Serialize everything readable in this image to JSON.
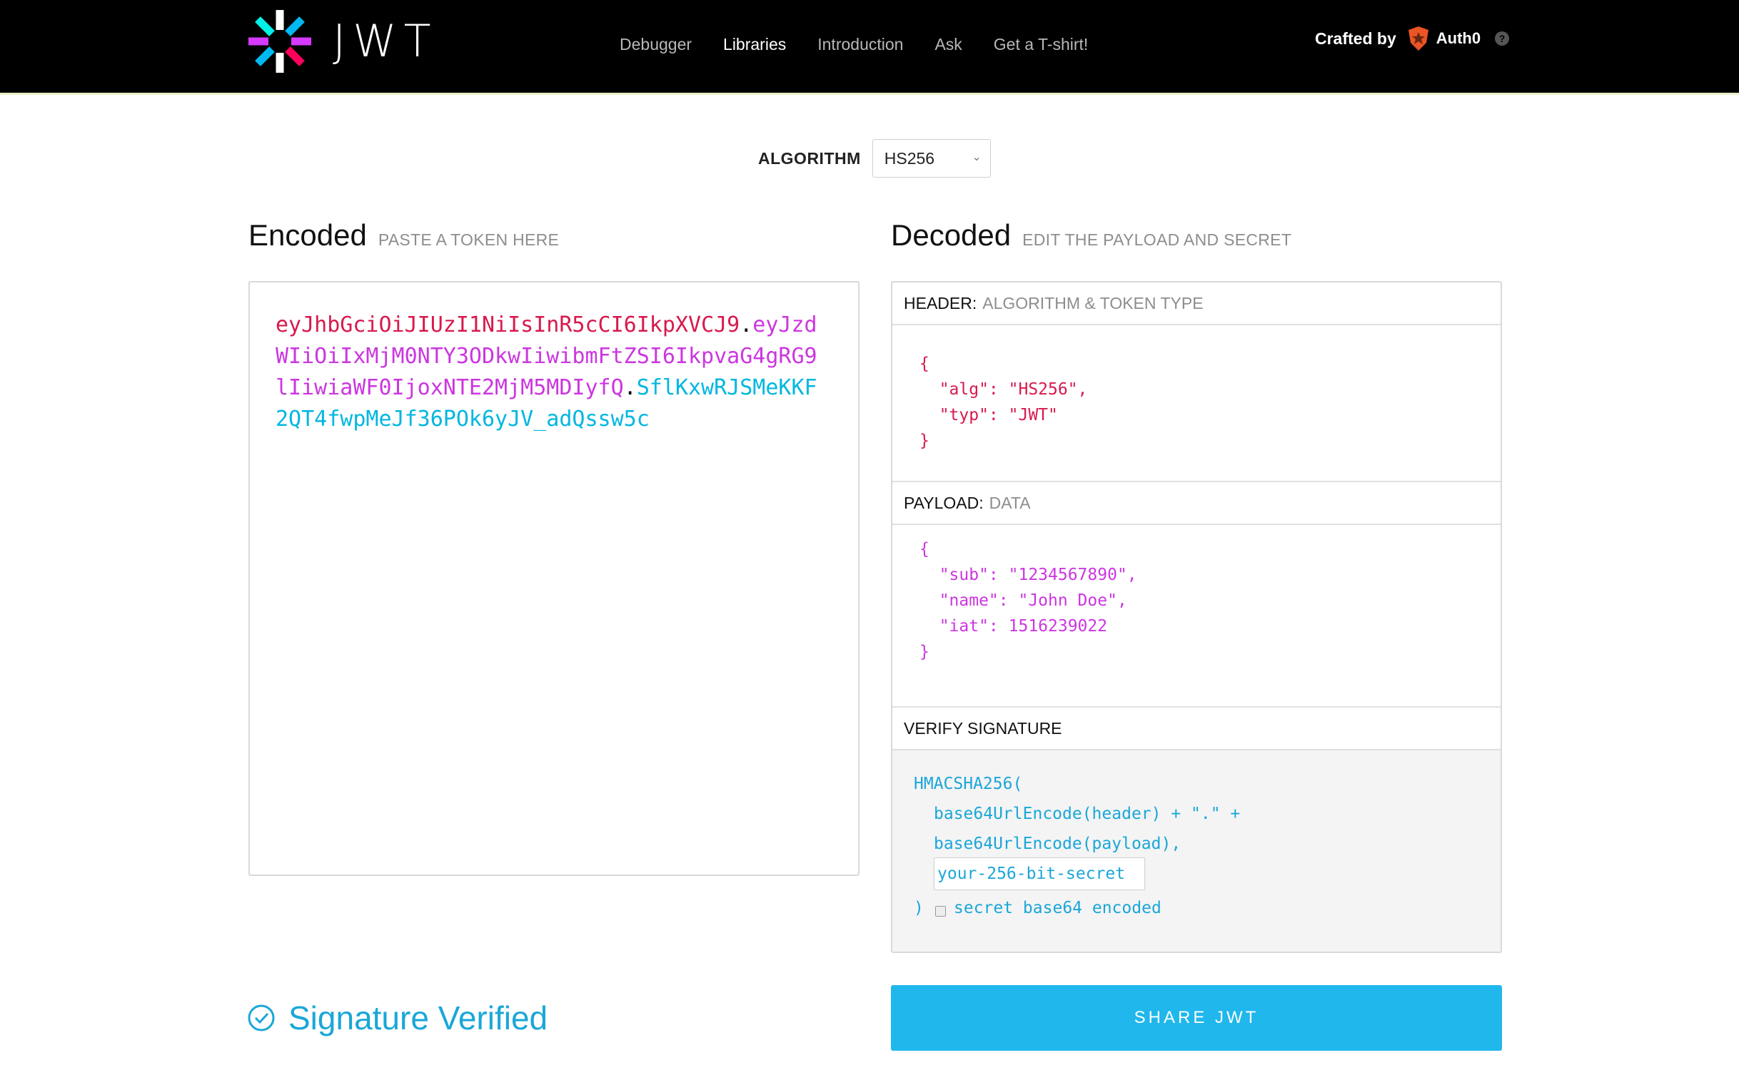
{
  "brand": {
    "name": "JWT"
  },
  "nav": {
    "items": [
      "Debugger",
      "Libraries",
      "Introduction",
      "Ask",
      "Get a T-shirt!"
    ],
    "active": "Libraries"
  },
  "crafted": {
    "label": "Crafted by",
    "company": "Auth0",
    "help_glyph": "?"
  },
  "algorithm": {
    "label": "ALGORITHM",
    "value": "HS256"
  },
  "encoded": {
    "title": "Encoded",
    "hint": "PASTE A TOKEN HERE",
    "token_header": "eyJhbGciOiJIUzI1NiIsInR5cCI6IkpXVCJ9",
    "token_payload": "eyJzdWIiOiIxMjM0NTY3ODkwIiwibmFtZSI6IkpvaG4gRG9lIiwiaWF0IjoxNTE2MjM5MDIyfQ",
    "token_signature": "SflKxwRJSMeKKF2QT4fwpMeJf36POk6yJV_adQssw5c",
    "dot": "."
  },
  "decoded": {
    "title": "Decoded",
    "hint": "EDIT THE PAYLOAD AND SECRET",
    "header_section": {
      "label": "HEADER:",
      "sublabel": "ALGORITHM & TOKEN TYPE",
      "json": "{\n  \"alg\": \"HS256\",\n  \"typ\": \"JWT\"\n}"
    },
    "payload_section": {
      "label": "PAYLOAD:",
      "sublabel": "DATA",
      "json": "{\n  \"sub\": \"1234567890\",\n  \"name\": \"John Doe\",\n  \"iat\": 1516239022\n}"
    },
    "verify_section": {
      "label": "VERIFY SIGNATURE",
      "line1": "HMACSHA256(",
      "line2": "base64UrlEncode(header) + \".\" +",
      "line3": "base64UrlEncode(payload),",
      "secret_placeholder": "your-256-bit-secret",
      "close_paren": ")",
      "checkbox_label": "secret base64 encoded"
    }
  },
  "status": {
    "text": "Signature Verified"
  },
  "share_button": {
    "label": "SHARE JWT"
  },
  "colors": {
    "header_red": "#d8194c",
    "payload_pink": "#cc36e0",
    "signature_cyan": "#00b7e0",
    "button_blue": "#1fb7ec"
  }
}
